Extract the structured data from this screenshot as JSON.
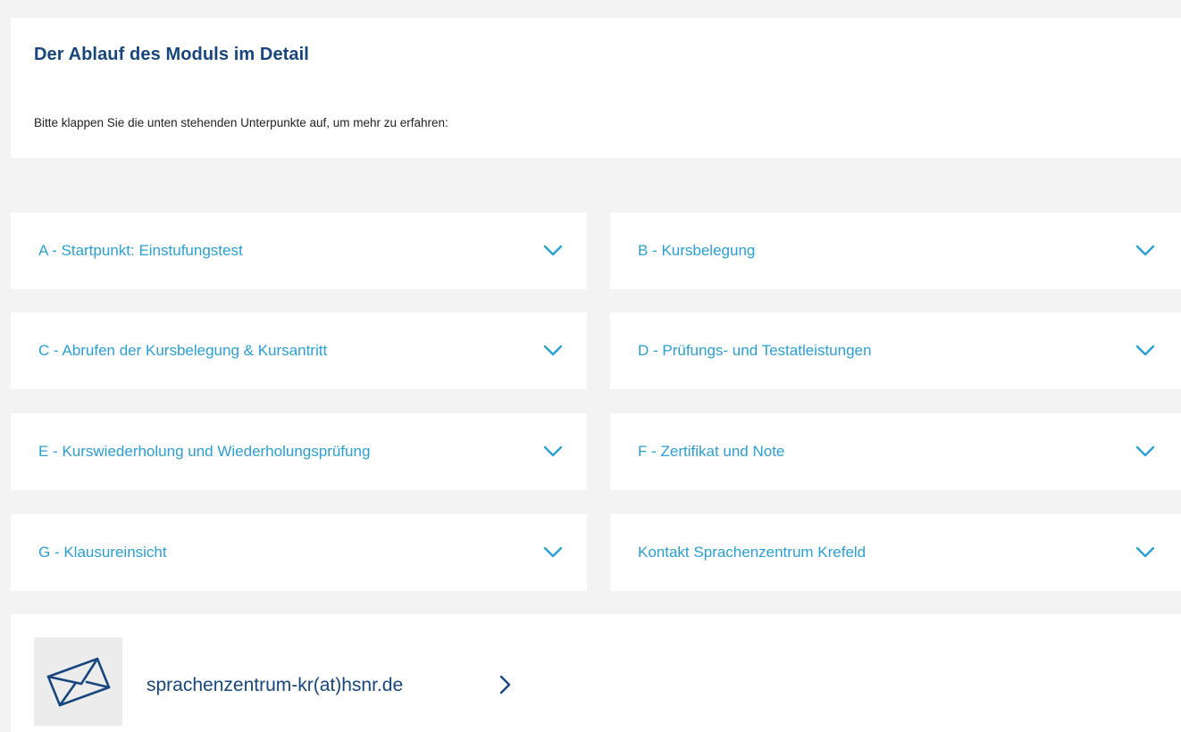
{
  "section": {
    "title": "Der Ablauf des Moduls im Detail",
    "intro": "Bitte klappen Sie die unten stehenden Unterpunkte auf, um mehr zu erfahren:"
  },
  "accordion": {
    "items": [
      {
        "label": "A - Startpunkt: Einstufungstest",
        "icon": "chevron-down-icon"
      },
      {
        "label": "B - Kursbelegung",
        "icon": "chevron-down-icon"
      },
      {
        "label": "C - Abrufen der Kursbelegung & Kursantritt",
        "icon": "chevron-down-icon"
      },
      {
        "label": "D - Prüfungs- und Testatleistungen",
        "icon": "chevron-down-icon"
      },
      {
        "label": "E - Kurswiederholung und Wiederholungsprüfung",
        "icon": "chevron-down-icon"
      },
      {
        "label": "F - Zertifikat und Note",
        "icon": "chevron-down-icon"
      },
      {
        "label": "G - Klausureinsicht",
        "icon": "chevron-down-icon"
      },
      {
        "label": "Kontakt Sprachenzentrum Krefeld",
        "icon": "chevron-down-icon"
      }
    ]
  },
  "contact": {
    "email": "sprachenzentrum-kr(at)hsnr.de",
    "icon": "envelope-icon",
    "arrow_icon": "chevron-right-icon"
  },
  "colors": {
    "heading": "#17467e",
    "link": "#2a9fd6",
    "background": "#f3f3f3",
    "panel": "#ffffff"
  }
}
